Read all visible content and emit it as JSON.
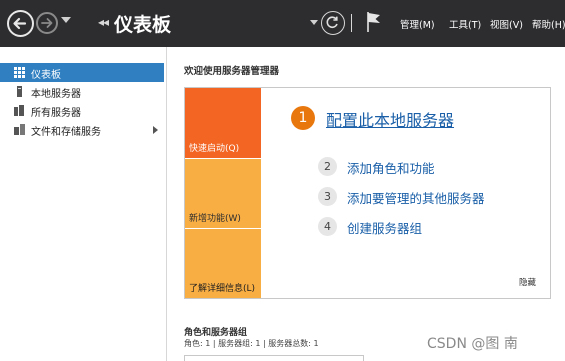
{
  "header": {
    "title": "仪表板",
    "menus": [
      "管理(M)",
      "工具(T)",
      "视图(V)",
      "帮助(H)"
    ]
  },
  "sidebar": {
    "items": [
      {
        "label": "仪表板",
        "icon": "dashboard-icon"
      },
      {
        "label": "本地服务器",
        "icon": "local-server-icon"
      },
      {
        "label": "所有服务器",
        "icon": "all-servers-icon"
      },
      {
        "label": "文件和存储服务",
        "icon": "file-storage-icon"
      }
    ]
  },
  "main": {
    "welcome": "欢迎使用服务器管理器",
    "tiles": [
      "快速启动(Q)",
      "新增功能(W)",
      "了解详细信息(L)"
    ],
    "steps": [
      {
        "num": "1",
        "label": "配置此本地服务器"
      },
      {
        "num": "2",
        "label": "添加角色和功能"
      },
      {
        "num": "3",
        "label": "添加要管理的其他服务器"
      },
      {
        "num": "4",
        "label": "创建服务器组"
      }
    ],
    "hide": "隐藏",
    "roles_title": "角色和服务器组",
    "roles_counts": "角色: 1 | 服务器组: 1 | 服务器总数: 1"
  },
  "watermark": "CSDN @图  南",
  "colors": {
    "titlebar": "#2d2d30",
    "sidebar_active": "#2f7fc1",
    "tile_primary": "#f26522",
    "tile_secondary": "#f9ae44",
    "link": "#1a5fa8"
  }
}
